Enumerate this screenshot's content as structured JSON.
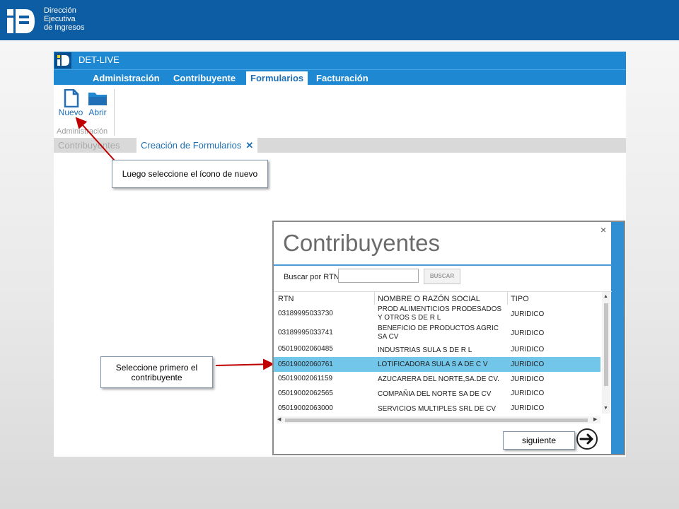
{
  "header": {
    "logo_line1": "Dirección",
    "logo_line2": "Ejecutiva",
    "logo_line3": "de Ingresos",
    "brand_color": "#0c5da3"
  },
  "app": {
    "title": "DET-LIVE",
    "accent_color": "#1e88d3",
    "menu": [
      "Administración",
      "Contribuyente",
      "Formularios",
      "Facturación"
    ],
    "active_menu": "Formularios",
    "ribbon": {
      "new_label": "Nuevo",
      "open_label": "Abrir",
      "group_label": "Administración"
    },
    "tabs": {
      "inactive": "Contribuyentes",
      "active": "Creación de Formularios",
      "close_symbol": "✕"
    }
  },
  "callouts": {
    "new_icon": "Luego seleccione el ícono de nuevo",
    "select_taxpayer": "Seleccione primero el contribuyente"
  },
  "dialog": {
    "title": "Contribuyentes",
    "close_symbol": "×",
    "search_label": "Buscar por RTN",
    "search_value": "",
    "search_button": "BUSCAR",
    "columns": [
      "RTN",
      "NOMBRE O RAZÓN SOCIAL",
      "TIPO"
    ],
    "rows": [
      {
        "rtn": "03189995033730",
        "name": "PROD ALIMENTICIOS PRODESADOS Y OTROS S DE R L",
        "type": "JURIDICO"
      },
      {
        "rtn": "03189995033741",
        "name": "BENEFICIO DE PRODUCTOS AGRIC SA CV",
        "type": "JURIDICO"
      },
      {
        "rtn": "05019002060485",
        "name": "INDUSTRIAS SULA S DE R L",
        "type": "JURIDICO"
      },
      {
        "rtn": "05019002060761",
        "name": "LOTIFICADORA SULA S A DE C V",
        "type": "JURIDICO"
      },
      {
        "rtn": "05019002061159",
        "name": "AZUCARERA DEL NORTE,SA.DE CV.",
        "type": "JURIDICO"
      },
      {
        "rtn": "05019002062565",
        "name": "COMPAÑIA DEL NORTE SA DE CV",
        "type": "JURIDICO"
      },
      {
        "rtn": "05019002063000",
        "name": "SERVICIOS MULTIPLES SRL DE CV",
        "type": "JURIDICO"
      }
    ],
    "selected_row_index": 3,
    "selected_color": "#72c6ea",
    "next_label": "siguiente",
    "next_icon": "arrow-right-circle-icon"
  }
}
